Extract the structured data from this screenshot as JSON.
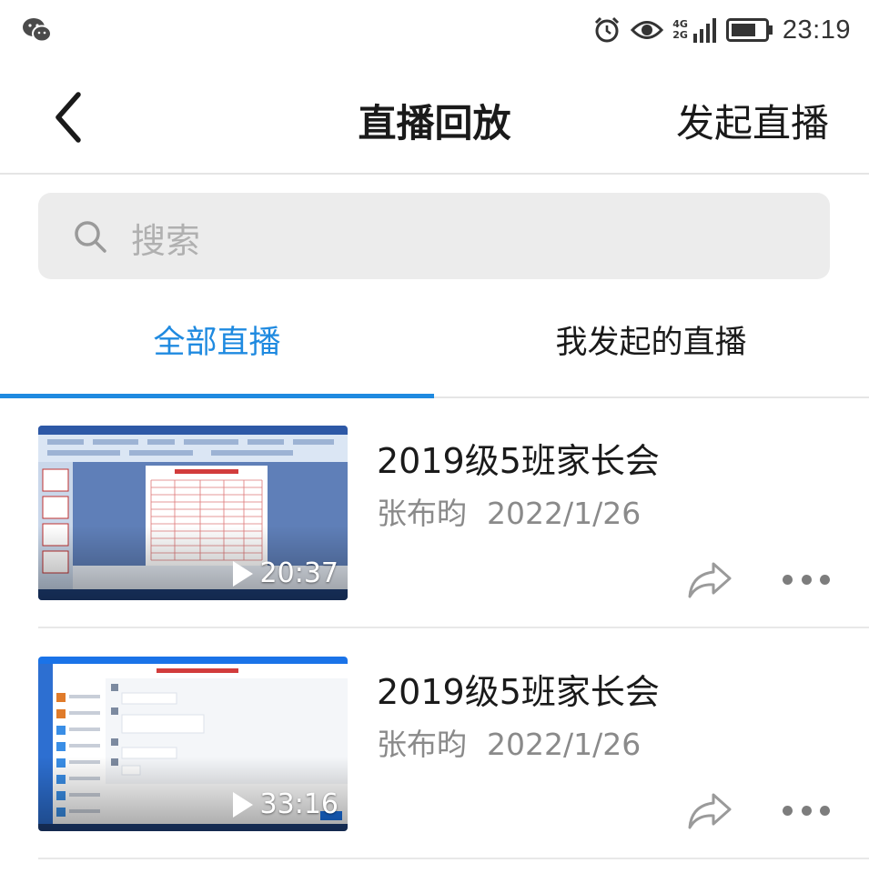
{
  "status_bar": {
    "time": "23:19",
    "network_top": "4G",
    "network_bottom": "2G",
    "icons": [
      "wechat-icon",
      "alarm-icon",
      "eye-icon",
      "signal-icon",
      "battery-icon"
    ]
  },
  "nav": {
    "title": "直播回放",
    "right_action": "发起直播",
    "back_icon": "chevron-left-icon"
  },
  "search": {
    "placeholder": "搜索",
    "icon": "search-icon"
  },
  "tabs": [
    {
      "label": "全部直播",
      "active": true
    },
    {
      "label": "我发起的直播",
      "active": false
    }
  ],
  "colors": {
    "accent": "#1f8ae0",
    "text_primary": "#1a1a1a",
    "text_secondary": "#8a8a8a",
    "search_bg": "#ececec"
  },
  "items": [
    {
      "title": "2019级5班家长会",
      "author": "张布昀",
      "date": "2022/1/26",
      "duration": "20:37"
    },
    {
      "title": "2019级5班家长会",
      "author": "张布昀",
      "date": "2022/1/26",
      "duration": "33:16"
    }
  ]
}
